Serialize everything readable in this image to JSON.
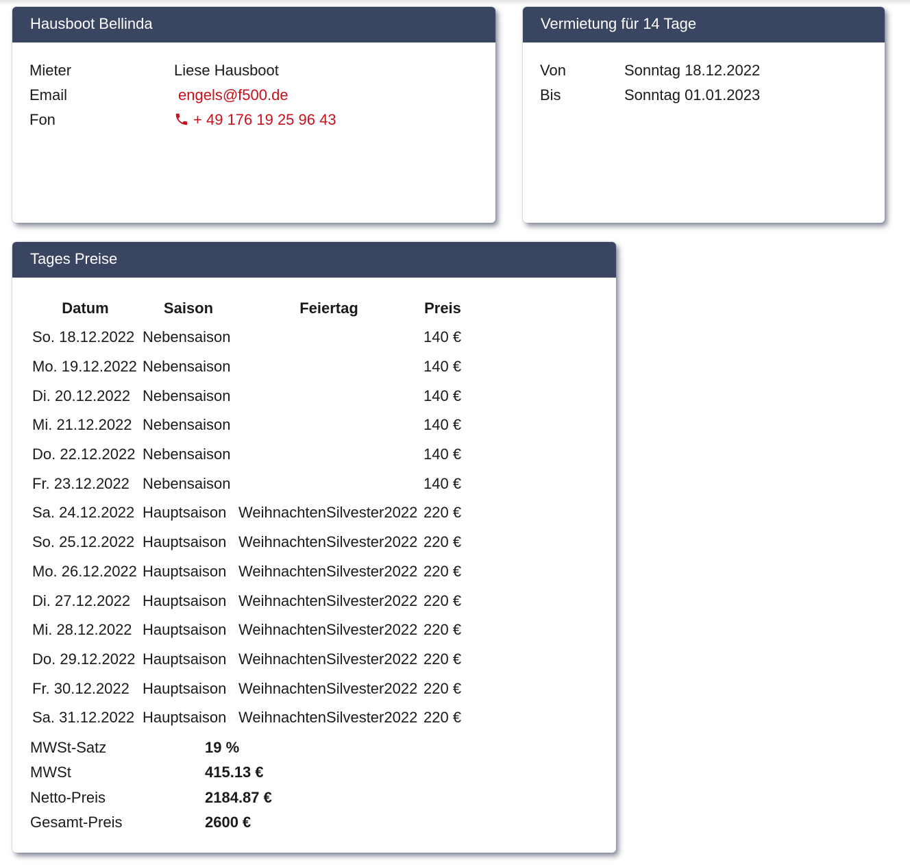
{
  "boat_card": {
    "title": "Hausboot Bellinda",
    "tenant_label": "Mieter",
    "tenant_value": "Liese Hausboot",
    "email_label": "Email",
    "email_value": "engels@f500.de",
    "phone_label": "Fon",
    "phone_value": "+ 49 176 19 25 96 43",
    "phone_icon": "phone-icon"
  },
  "rental_card": {
    "title": "Vermietung für 14 Tage",
    "from_label": "Von",
    "from_value": "Sonntag 18.12.2022",
    "to_label": "Bis",
    "to_value": "Sonntag 01.01.2023"
  },
  "prices_card": {
    "title": "Tages Preise",
    "columns": [
      "Datum",
      "Saison",
      "Feiertag",
      "Preis"
    ],
    "rows": [
      [
        "So. 18.12.2022",
        "Nebensaison",
        "",
        "140 €"
      ],
      [
        "Mo. 19.12.2022",
        "Nebensaison",
        "",
        "140 €"
      ],
      [
        "Di. 20.12.2022",
        "Nebensaison",
        "",
        "140 €"
      ],
      [
        "Mi. 21.12.2022",
        "Nebensaison",
        "",
        "140 €"
      ],
      [
        "Do. 22.12.2022",
        "Nebensaison",
        "",
        "140 €"
      ],
      [
        "Fr. 23.12.2022",
        "Nebensaison",
        "",
        "140 €"
      ],
      [
        "Sa. 24.12.2022",
        "Hauptsaison",
        "WeihnachtenSilvester2022",
        "220 €"
      ],
      [
        "So. 25.12.2022",
        "Hauptsaison",
        "WeihnachtenSilvester2022",
        "220 €"
      ],
      [
        "Mo. 26.12.2022",
        "Hauptsaison",
        "WeihnachtenSilvester2022",
        "220 €"
      ],
      [
        "Di. 27.12.2022",
        "Hauptsaison",
        "WeihnachtenSilvester2022",
        "220 €"
      ],
      [
        "Mi. 28.12.2022",
        "Hauptsaison",
        "WeihnachtenSilvester2022",
        "220 €"
      ],
      [
        "Do. 29.12.2022",
        "Hauptsaison",
        "WeihnachtenSilvester2022",
        "220 €"
      ],
      [
        "Fr. 30.12.2022",
        "Hauptsaison",
        "WeihnachtenSilvester2022",
        "220 €"
      ],
      [
        "Sa. 31.12.2022",
        "Hauptsaison",
        "WeihnachtenSilvester2022",
        "220 €"
      ]
    ],
    "summary": [
      {
        "label": "MWSt-Satz",
        "value": "19 %"
      },
      {
        "label": "MWSt",
        "value": "415.13 €"
      },
      {
        "label": "Netto-Preis",
        "value": "2184.87 €"
      },
      {
        "label": "Gesamt-Preis",
        "value": "2600 €"
      }
    ]
  },
  "colors": {
    "header_bg": "#3a4562",
    "link_red": "#c8101b"
  }
}
